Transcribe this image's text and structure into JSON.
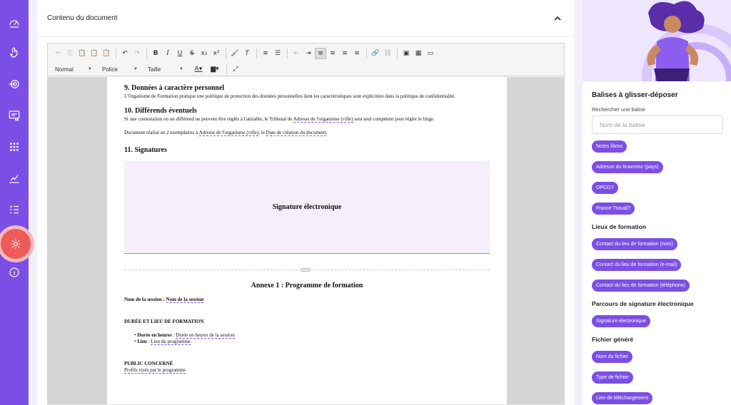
{
  "sidebar": {
    "icons": [
      "speed-icon",
      "touch-icon",
      "target-icon",
      "certificate-icon",
      "dots-grid-icon",
      "chart-icon",
      "checklist-icon",
      "settings-gear-icon",
      "info-shield-icon"
    ]
  },
  "main": {
    "title": "Contenu du document"
  },
  "toolbar": {
    "format_label": "Normal",
    "font_label": "Police",
    "size_label": "Taille"
  },
  "document": {
    "sec9_title": "9. Données à caractère personnel",
    "sec9_text": "L'Organisme de Formation pratique une politique de protection des données personnelles dont les caractéristiques sont explicitées dans la politique de confidentialité.",
    "sec10_title": "10. Différends éventuels",
    "sec10_text_a": "Si une contestation ou un différend ne peuvent être réglés à l'amiable, le Tribunal de ",
    "sec10_tag": "Adresse de l'organisme (ville)",
    "sec10_text_b": "  sera seul compétent pour régler le litige.",
    "realise_a": "Document réalisé en 2 exemplaires à ",
    "realise_tag1": "Adresse de l'organisme (ville)",
    "realise_b": ", le ",
    "realise_tag2": "Date de création du document",
    "realise_c": ".",
    "sec11_title": "11. Signatures",
    "signature_box": "Signature électronique",
    "annexe_title": "Annexe 1 : Programme de formation",
    "session_label": "Nom de la session : ",
    "session_tag": "Nom de la session",
    "duree_title": "DURÉE ET LIEU DE FORMATION",
    "duree_label": "Durée en heures",
    "duree_sep": " : ",
    "duree_tag": "Durée en heures de la session",
    "lieu_label": "Lieu",
    "lieu_sep": " : ",
    "lieu_tag": "Lieu du programme",
    "public_title": "PUBLIC CONCERNÉ",
    "public_tag": "Profils visés par le programme"
  },
  "right_panel": {
    "title": "Balises à glisser-déposer",
    "search_label": "Rechercher une balise",
    "search_placeholder": "Nom de la balise",
    "chips_top": [
      "Notes libres",
      "Adresse du financeur (pays)",
      "OPCO?",
      "France Travail?"
    ],
    "group_lieux_title": "Lieux de formation",
    "chips_lieux": [
      "Contact du lieu de formation (nom)",
      "Contact du lieu de formation (e-mail)",
      "Contact du lieu de formation (téléphone)"
    ],
    "group_parcours_title": "Parcours de signature électronique",
    "chips_parcours": [
      "Signature électronique"
    ],
    "group_fichier_title": "Fichier généré",
    "chips_fichier": [
      "Nom du fichier",
      "Type de fichier",
      "Lien de téléchargement"
    ]
  },
  "colors": {
    "sidebar": "#7b4fe6",
    "active_nav": "#ef5a5a",
    "chip": "#7b4fe6",
    "signature_bg": "#f6eefb"
  }
}
